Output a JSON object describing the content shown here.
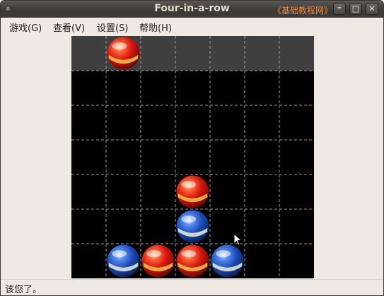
{
  "window": {
    "title": "Four-in-a-row",
    "watermark": "《基础教程网》",
    "buttons": {
      "minimize": "–",
      "maximize": "□",
      "close": "✕"
    }
  },
  "menu": {
    "items": [
      {
        "label": "游戏(G)"
      },
      {
        "label": "查看(V)"
      },
      {
        "label": "设置(S)"
      },
      {
        "label": "帮助(H)"
      }
    ]
  },
  "board": {
    "columns": 7,
    "rows": 6,
    "cursor_piece": {
      "color": "red",
      "column": 1
    },
    "cells": [
      [
        null,
        null,
        null,
        null,
        null,
        null,
        null
      ],
      [
        null,
        null,
        null,
        null,
        null,
        null,
        null
      ],
      [
        null,
        null,
        null,
        null,
        null,
        null,
        null
      ],
      [
        null,
        null,
        null,
        "red",
        null,
        null,
        null
      ],
      [
        null,
        null,
        null,
        "blue",
        null,
        null,
        null
      ],
      [
        null,
        "blue",
        "red",
        "red",
        "blue",
        null,
        null
      ]
    ],
    "colors": {
      "background": "#000000",
      "drop_row": "#3f3f3f",
      "grid": "#9a9a9a",
      "red": "#e0241b",
      "blue": "#2456c8"
    }
  },
  "status": {
    "text": "该您了。"
  }
}
